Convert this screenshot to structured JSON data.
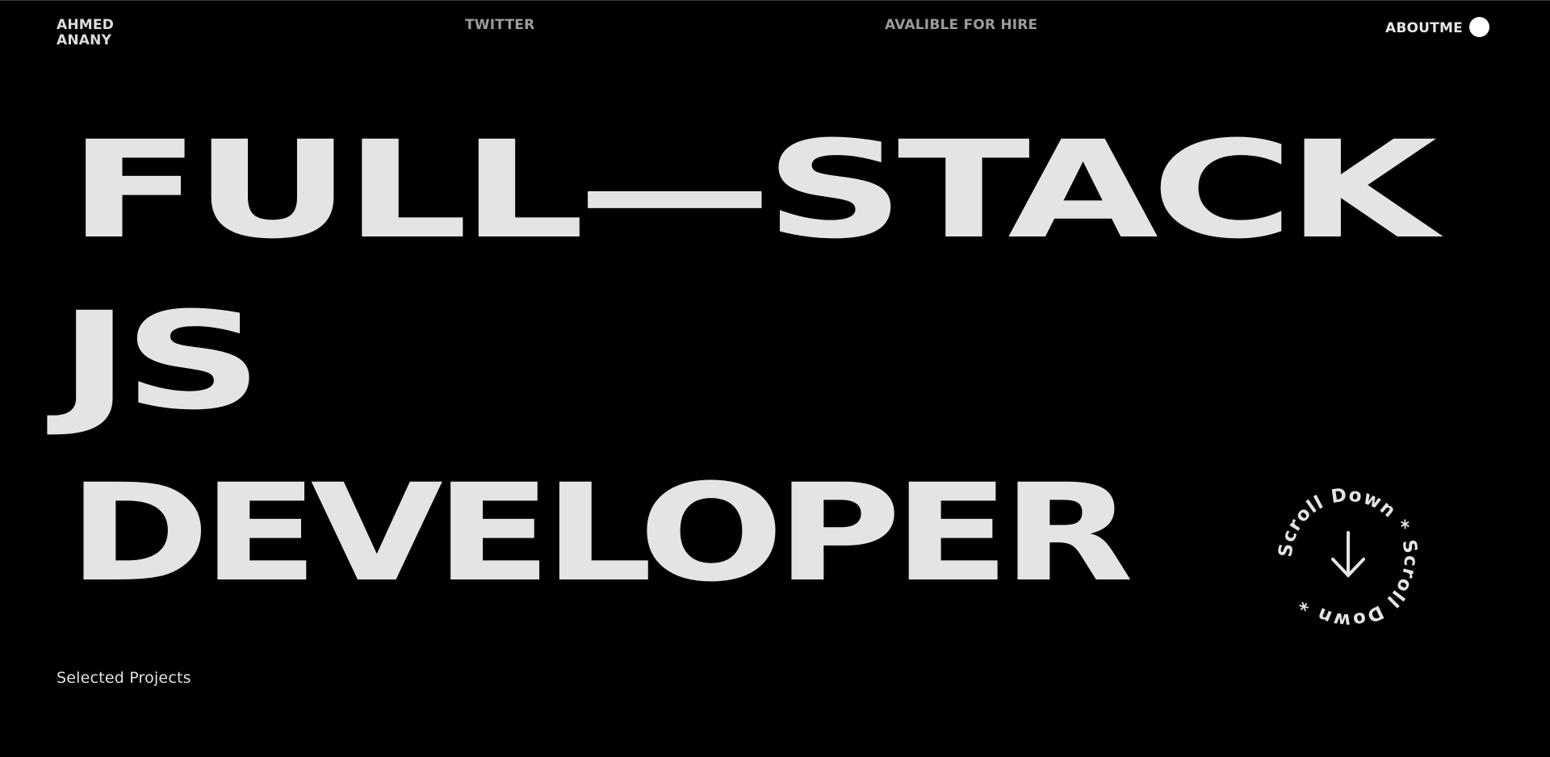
{
  "nav": {
    "brand_line1": "AHMED",
    "brand_line2": "ANANY",
    "twitter": "TWITTER",
    "hire": "AVALIBLE FOR HIRE",
    "about": "ABOUTME"
  },
  "hero": {
    "line1": "FULL—STACK",
    "line2": "JS",
    "line3": "DEVELOPER"
  },
  "scroll_badge": {
    "ring_text": "Scroll Down * Scroll Down * ",
    "icon": "arrow-down-icon"
  },
  "section": {
    "selected_projects": "Selected Projects"
  },
  "colors": {
    "background": "#000000",
    "text": "#e4e4e4",
    "muted": "#9b9b9b"
  }
}
